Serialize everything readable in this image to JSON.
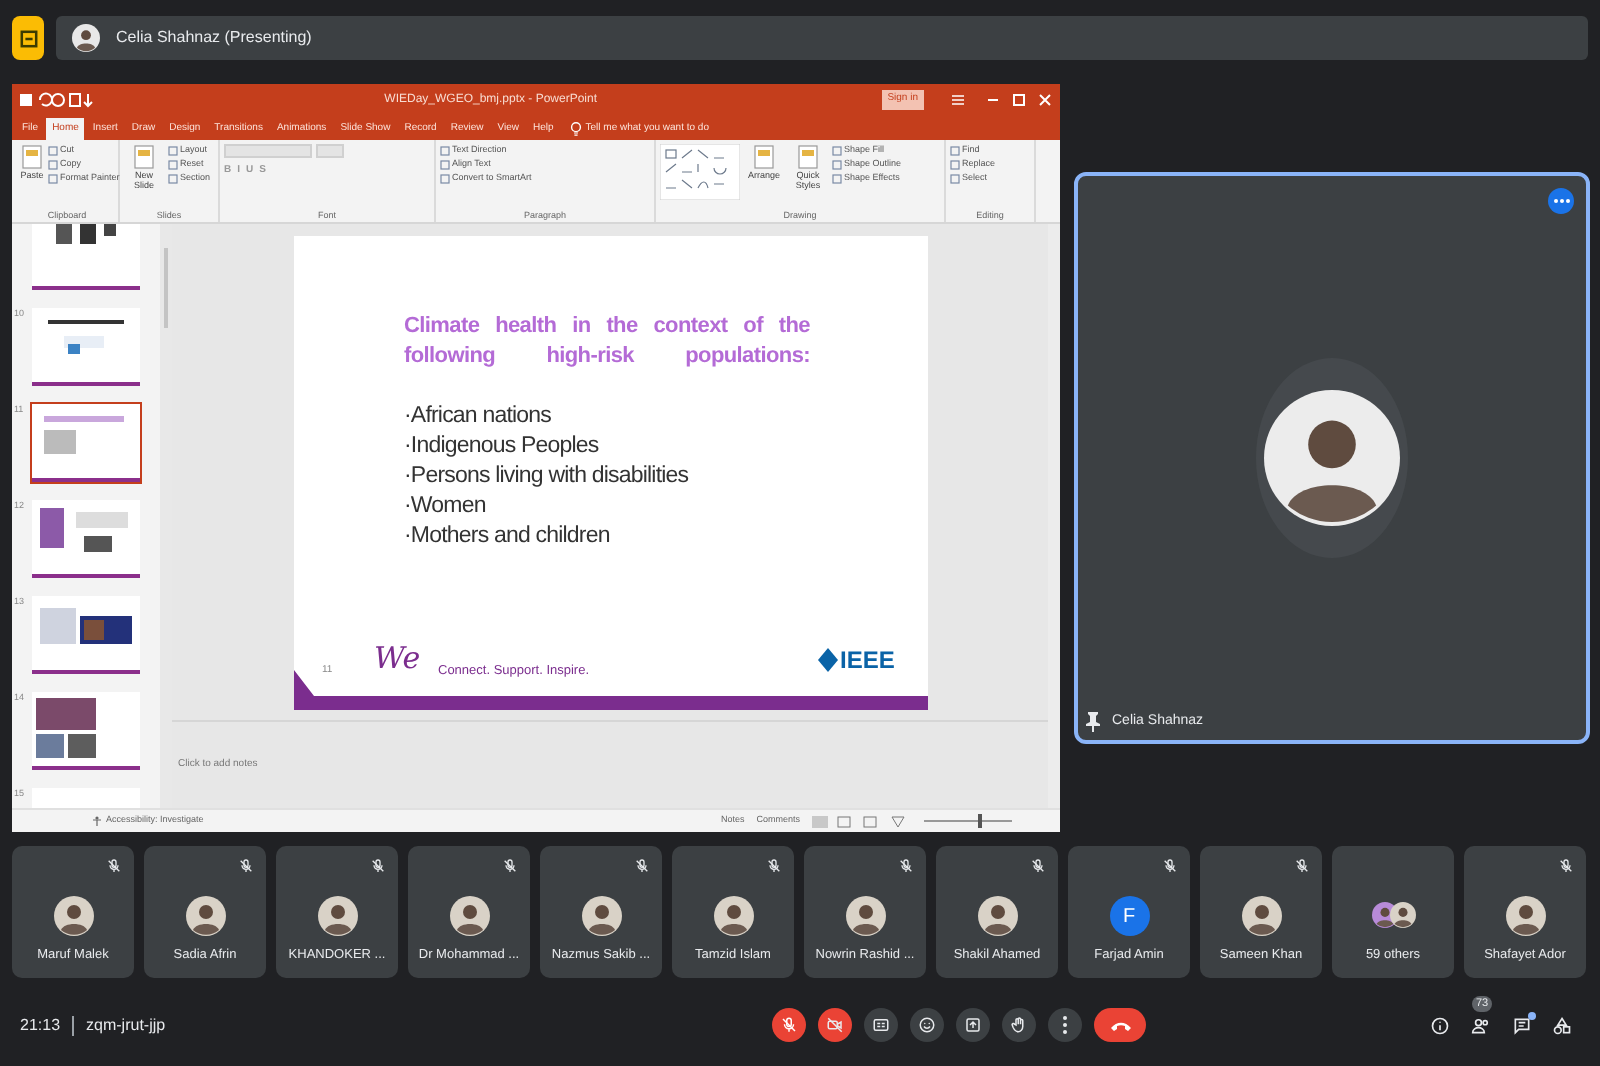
{
  "top_bar": {
    "presenter": "Celia Shahnaz (Presenting)"
  },
  "powerpoint": {
    "title": "WIEDay_WGEO_bmj.pptx - PowerPoint",
    "sign_in": "Sign in",
    "tabs": [
      {
        "label": "File",
        "selected": false
      },
      {
        "label": "Home",
        "selected": true
      },
      {
        "label": "Insert",
        "selected": false
      },
      {
        "label": "Draw",
        "selected": false
      },
      {
        "label": "Design",
        "selected": false
      },
      {
        "label": "Transitions",
        "selected": false
      },
      {
        "label": "Animations",
        "selected": false
      },
      {
        "label": "Slide Show",
        "selected": false
      },
      {
        "label": "Record",
        "selected": false
      },
      {
        "label": "Review",
        "selected": false
      },
      {
        "label": "View",
        "selected": false
      },
      {
        "label": "Help",
        "selected": false
      }
    ],
    "tell_me": "Tell me what you want to do",
    "ribbon_groups": [
      {
        "name": "Clipboard",
        "items": [
          {
            "kind": "large",
            "label": "Paste"
          },
          {
            "kind": "small",
            "label": "Cut"
          },
          {
            "kind": "small",
            "label": "Copy"
          },
          {
            "kind": "small",
            "label": "Format Painter"
          }
        ]
      },
      {
        "name": "Slides",
        "items": [
          {
            "kind": "large",
            "label": "New Slide"
          },
          {
            "kind": "small",
            "label": "Layout"
          },
          {
            "kind": "small",
            "label": "Reset"
          },
          {
            "kind": "small",
            "label": "Section"
          }
        ]
      },
      {
        "name": "Font",
        "items": [
          {
            "kind": "format",
            "label": "B"
          },
          {
            "kind": "format",
            "label": "I"
          },
          {
            "kind": "format",
            "label": "U"
          },
          {
            "kind": "format",
            "label": "S"
          }
        ]
      },
      {
        "name": "Paragraph",
        "items": [
          {
            "kind": "small",
            "label": "Text Direction"
          },
          {
            "kind": "small",
            "label": "Align Text"
          },
          {
            "kind": "small",
            "label": "Convert to SmartArt"
          }
        ]
      },
      {
        "name": "Drawing",
        "items": [
          {
            "kind": "gallery"
          },
          {
            "kind": "large",
            "label": "Arrange"
          },
          {
            "kind": "large",
            "label": "Quick Styles"
          },
          {
            "kind": "small",
            "label": "Shape Fill"
          },
          {
            "kind": "small",
            "label": "Shape Outline"
          },
          {
            "kind": "small",
            "label": "Shape Effects"
          }
        ]
      },
      {
        "name": "Editing",
        "items": [
          {
            "kind": "small",
            "label": "Find"
          },
          {
            "kind": "small",
            "label": "Replace"
          },
          {
            "kind": "small",
            "label": "Select"
          }
        ]
      }
    ],
    "thumbnails": [
      {
        "selected": false
      },
      {
        "number": "10",
        "selected": false
      },
      {
        "number": "11",
        "selected": true
      },
      {
        "number": "12",
        "selected": false
      },
      {
        "number": "13",
        "selected": false
      },
      {
        "number": "14",
        "selected": false
      },
      {
        "number": "15",
        "selected": false
      }
    ],
    "slide": {
      "title": "Climate health in the context of the following high-risk populations:",
      "bullets": [
        "·African nations",
        "·Indigenous Peoples",
        "·Persons living with disabilities",
        "·Women",
        "·Mothers and children"
      ],
      "page": "11",
      "wie_logo": "We",
      "tagline": "Connect. Support. Inspire.",
      "ieee_logo": "IEEE"
    },
    "notes_placeholder": "Click to add notes",
    "status": {
      "accessibility": "Accessibility: Investigate",
      "notes": "Notes",
      "comments": "Comments",
      "zoom": {
        "level": 0.65
      }
    }
  },
  "spotlight": {
    "name": "Celia Shahnaz",
    "pinned": true
  },
  "participants": [
    {
      "name": "Maruf Malek",
      "muted": true,
      "kind": "photo"
    },
    {
      "name": "Sadia Afrin",
      "muted": true,
      "kind": "photo"
    },
    {
      "name": "KHANDOKER ...",
      "muted": true,
      "kind": "photo"
    },
    {
      "name": "Dr Mohammad ...",
      "muted": true,
      "kind": "photo"
    },
    {
      "name": "Nazmus Sakib ...",
      "muted": true,
      "kind": "photo"
    },
    {
      "name": "Tamzid Islam",
      "muted": true,
      "kind": "photo"
    },
    {
      "name": "Nowrin Rashid ...",
      "muted": true,
      "kind": "photo"
    },
    {
      "name": "Shakil Ahamed",
      "muted": true,
      "kind": "photo"
    },
    {
      "name": "Farjad Amin",
      "muted": true,
      "kind": "letter",
      "letter": "F"
    },
    {
      "name": "Sameen Khan",
      "muted": true,
      "kind": "photo"
    },
    {
      "name": "59 others",
      "muted": false,
      "kind": "group"
    },
    {
      "name": "Shafayet Ador",
      "muted": true,
      "kind": "photo"
    }
  ],
  "bottom": {
    "time": "21:13",
    "meeting_code": "zqm-jrut-jjp",
    "controls": [
      {
        "kind": "mic",
        "on": false
      },
      {
        "kind": "camera",
        "on": false
      },
      {
        "kind": "captions"
      },
      {
        "kind": "emoji"
      },
      {
        "kind": "present"
      },
      {
        "kind": "hand"
      },
      {
        "kind": "more"
      },
      {
        "kind": "leave"
      }
    ],
    "people_count": "73",
    "chat_unread": true
  }
}
